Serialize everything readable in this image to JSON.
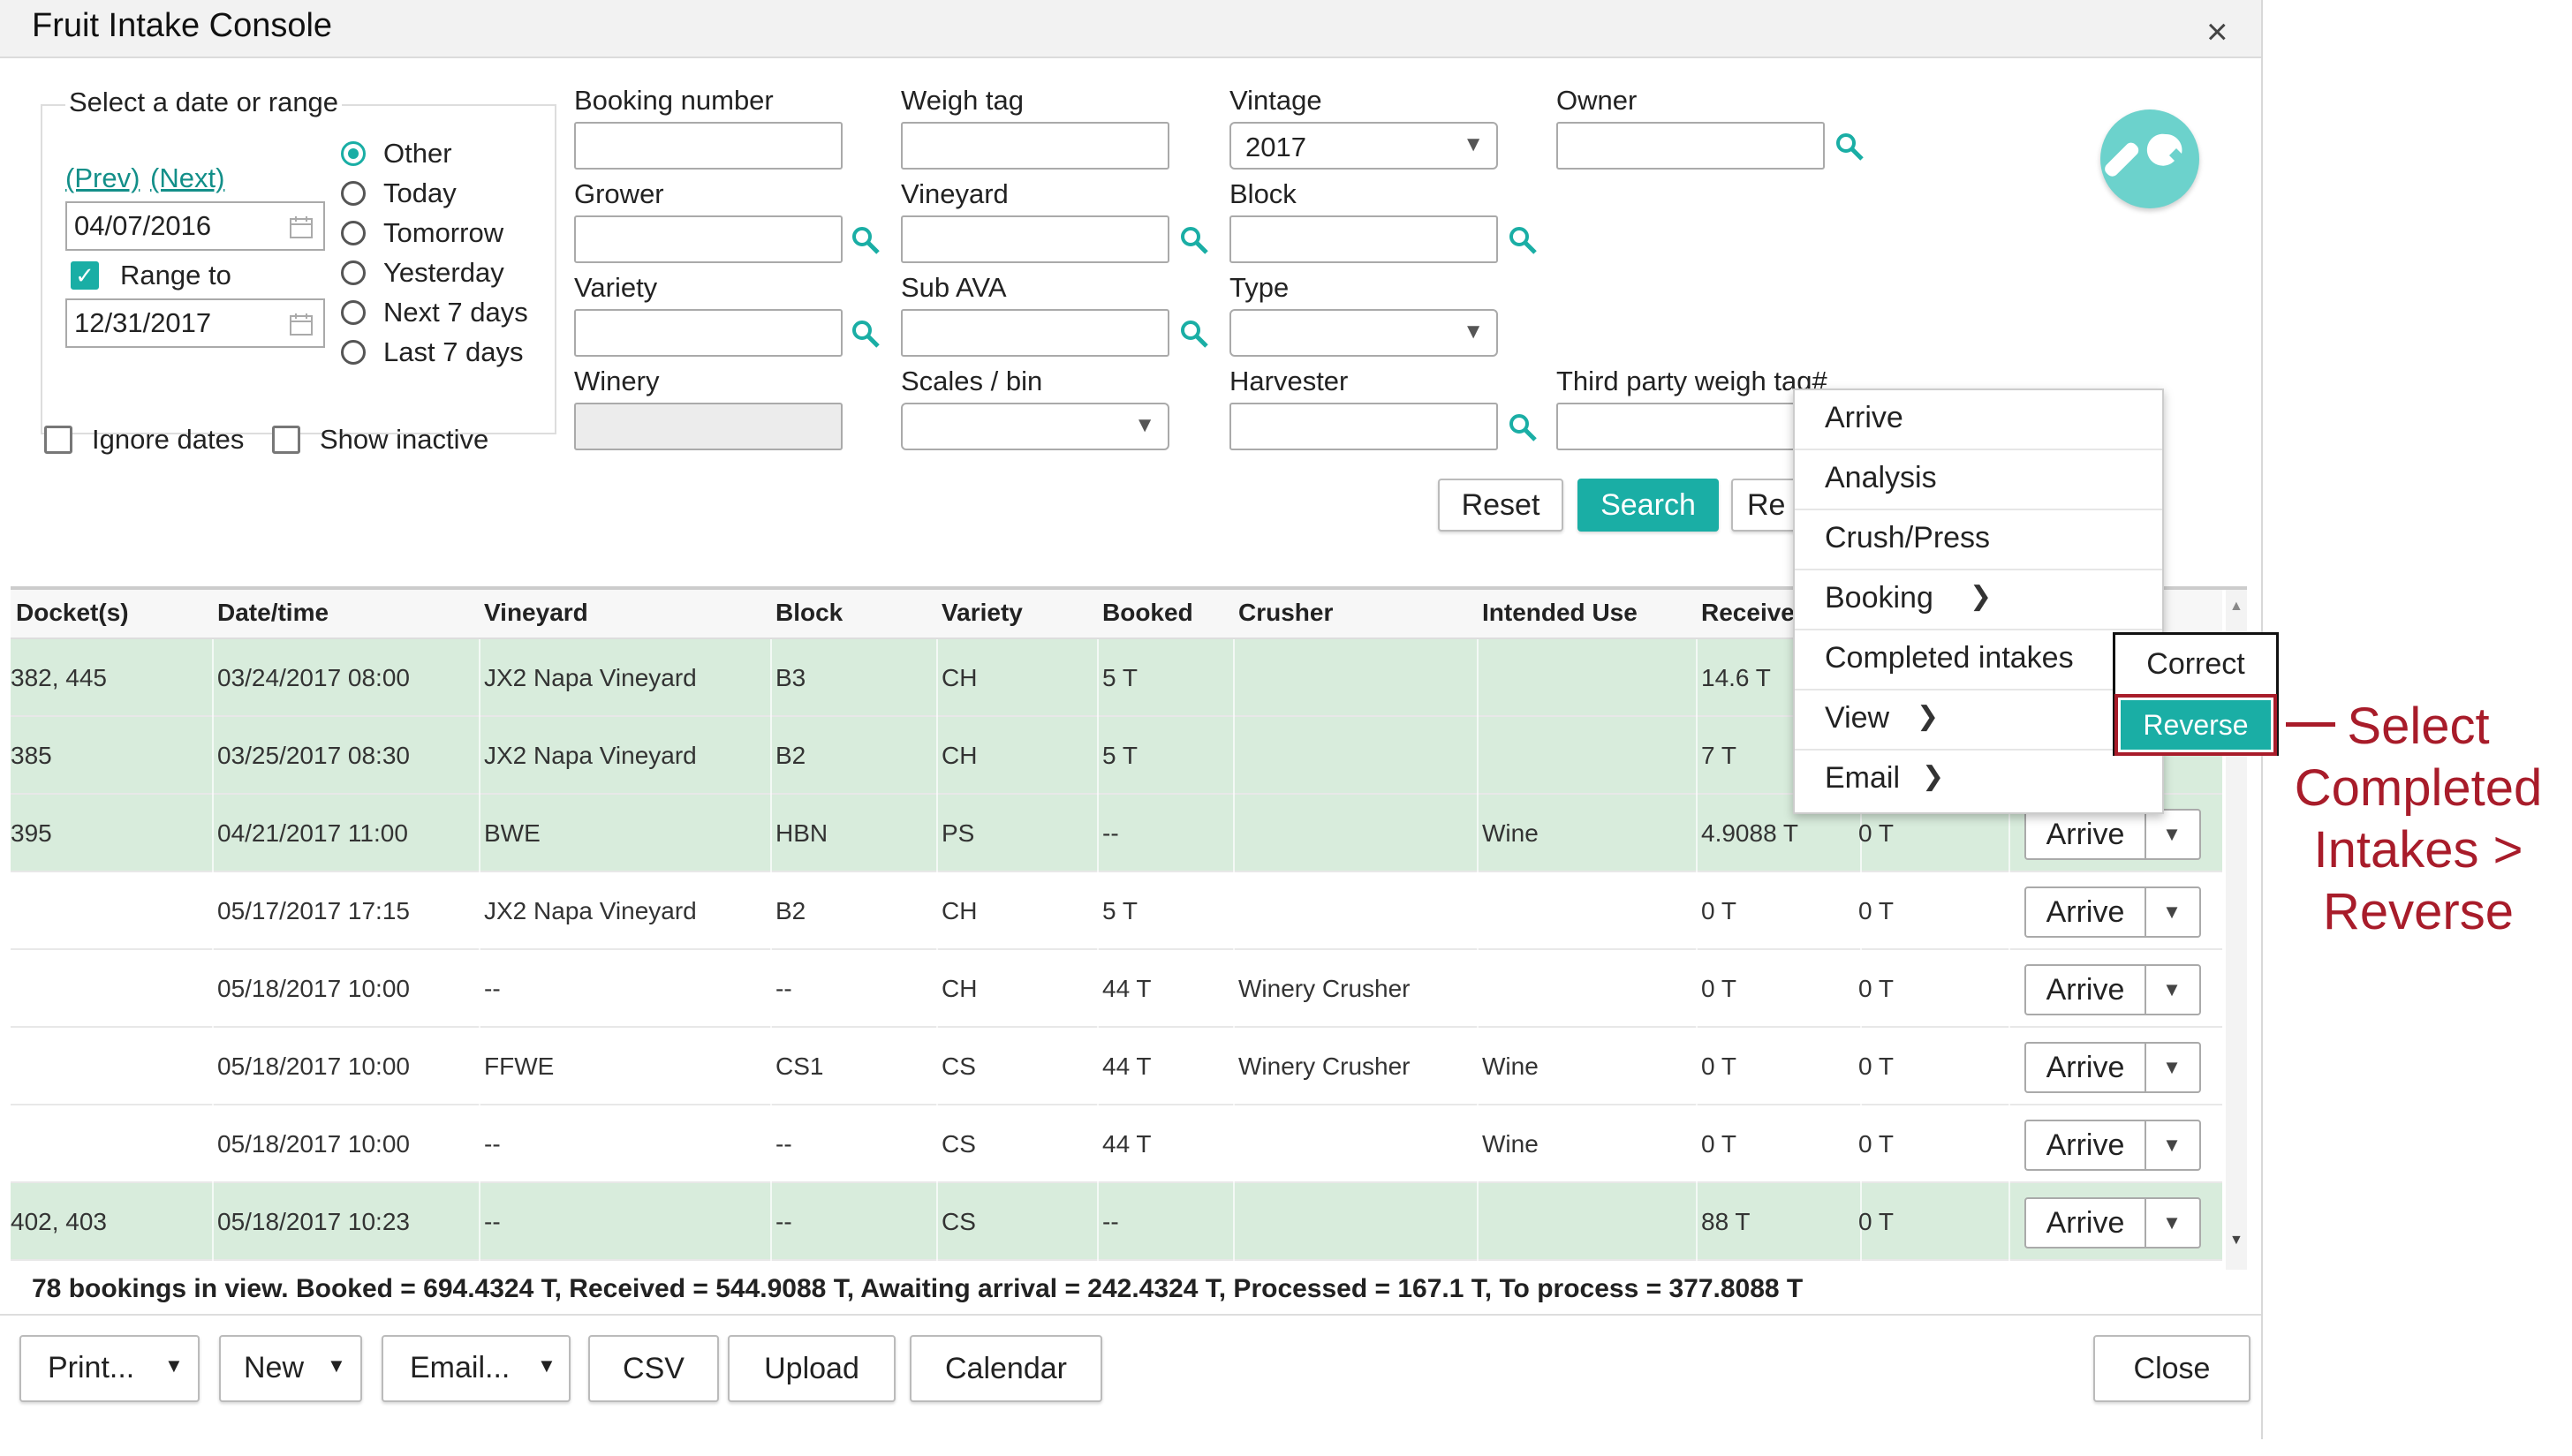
{
  "window": {
    "title": "Fruit Intake Console",
    "close_glyph": "×"
  },
  "date_section": {
    "heading": "Select a date or range",
    "prev_link": "(Prev)",
    "next_link": "(Next)",
    "from_date": "04/07/2016",
    "range_to_label": "Range to",
    "range_to_checked": true,
    "to_date": "12/31/2017",
    "options": [
      "Other",
      "Today",
      "Tomorrow",
      "Yesterday",
      "Next 7 days",
      "Last 7 days"
    ],
    "selected_option": "Other"
  },
  "checkboxes": {
    "ignore_dates": "Ignore dates",
    "show_inactive": "Show inactive"
  },
  "filters": {
    "booking_number": "Booking number",
    "weigh_tag": "Weigh tag",
    "vintage": "Vintage",
    "vintage_value": "2017",
    "owner": "Owner",
    "grower": "Grower",
    "vineyard": "Vineyard",
    "block": "Block",
    "variety": "Variety",
    "sub_ava": "Sub AVA",
    "type": "Type",
    "winery": "Winery",
    "scales_bin": "Scales / bin",
    "harvester": "Harvester",
    "third_party": "Third party weigh tag#"
  },
  "actions": {
    "reset": "Reset",
    "search": "Search",
    "re": "Re"
  },
  "table": {
    "columns": [
      "Docket(s)",
      "Date/time",
      "Vineyard",
      "Block",
      "Variety",
      "Booked",
      "Crusher",
      "Intended Use",
      "Receive"
    ],
    "rows": [
      {
        "docket": "382, 445",
        "datetime": "03/24/2017 08:00",
        "vineyard": "JX2 Napa Vineyard",
        "block": "B3",
        "variety": "CH",
        "booked": "5 T",
        "crusher": "",
        "use": "",
        "received": "14.6 T",
        "processed": "",
        "green": true
      },
      {
        "docket": "385",
        "datetime": "03/25/2017 08:30",
        "vineyard": "JX2 Napa Vineyard",
        "block": "B2",
        "variety": "CH",
        "booked": "5 T",
        "crusher": "",
        "use": "",
        "received": "7 T",
        "processed": "",
        "green": true
      },
      {
        "docket": "395",
        "datetime": "04/21/2017 11:00",
        "vineyard": "BWE",
        "block": "HBN",
        "variety": "PS",
        "booked": "--",
        "crusher": "",
        "use": "Wine",
        "received": "4.9088 T",
        "processed": "0 T",
        "green": true
      },
      {
        "docket": "",
        "datetime": "05/17/2017 17:15",
        "vineyard": "JX2 Napa Vineyard",
        "block": "B2",
        "variety": "CH",
        "booked": "5 T",
        "crusher": "",
        "use": "",
        "received": "0 T",
        "processed": "0 T",
        "green": false
      },
      {
        "docket": "",
        "datetime": "05/18/2017 10:00",
        "vineyard": "--",
        "block": "--",
        "variety": "CH",
        "booked": "44 T",
        "crusher": "Winery Crusher",
        "use": "",
        "received": "0 T",
        "processed": "0 T",
        "green": false
      },
      {
        "docket": "",
        "datetime": "05/18/2017 10:00",
        "vineyard": "FFWE",
        "block": "CS1",
        "variety": "CS",
        "booked": "44 T",
        "crusher": "Winery Crusher",
        "use": "Wine",
        "received": "0 T",
        "processed": "0 T",
        "green": false
      },
      {
        "docket": "",
        "datetime": "05/18/2017 10:00",
        "vineyard": "--",
        "block": "--",
        "variety": "CS",
        "booked": "44 T",
        "crusher": "",
        "use": "Wine",
        "received": "0 T",
        "processed": "0 T",
        "green": false
      },
      {
        "docket": "402, 403",
        "datetime": "05/18/2017 10:23",
        "vineyard": "--",
        "block": "--",
        "variety": "CS",
        "booked": "--",
        "crusher": "",
        "use": "",
        "received": "88 T",
        "processed": "0 T",
        "green": true
      }
    ],
    "row_button": "Arrive"
  },
  "summary": "78 bookings in view. Booked = 694.4324 T, Received = 544.9088 T, Awaiting arrival = 242.4324 T, Processed = 167.1 T, To process = 377.8088 T",
  "footer": {
    "print": "Print...",
    "new": "New",
    "email": "Email...",
    "csv": "CSV",
    "upload": "Upload",
    "calendar": "Calendar",
    "close": "Close"
  },
  "context_menu": [
    "Arrive",
    "Analysis",
    "Crush/Press",
    "Booking",
    "Completed intakes",
    "View",
    "Email"
  ],
  "submenu": {
    "correct": "Correct",
    "reverse": "Reverse"
  },
  "callout": [
    "Select",
    "Completed",
    "Intakes >",
    "Reverse"
  ],
  "colors": {
    "accent": "#1aaea5",
    "row_green": "#d8ecdc",
    "callout": "#a81c2a"
  }
}
